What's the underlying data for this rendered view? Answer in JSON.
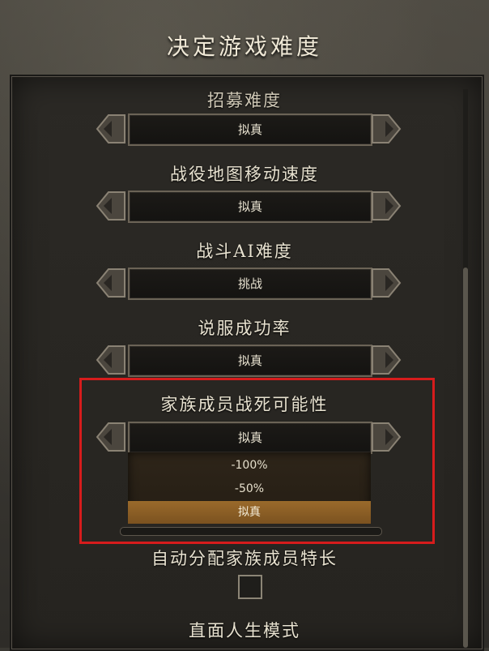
{
  "title": "决定游戏难度",
  "settings": [
    {
      "label": "招募难度",
      "value": "拟真"
    },
    {
      "label": "战役地图移动速度",
      "value": "拟真"
    },
    {
      "label": "战斗AI难度",
      "value": "挑战"
    },
    {
      "label": "说服成功率",
      "value": "拟真"
    },
    {
      "label": "家族成员战死可能性",
      "value": "拟真"
    }
  ],
  "dropdown_options": [
    {
      "label": "-100%",
      "selected": false
    },
    {
      "label": "-50%",
      "selected": false
    },
    {
      "label": "拟真",
      "selected": true
    }
  ],
  "auto_assign": {
    "label": "自动分配家族成员特长",
    "checked": false
  },
  "ironman": {
    "label": "直面人生模式"
  },
  "colors": {
    "highlight": "#d61c1c",
    "selected_option": "#8a5e26"
  },
  "icons": {
    "left_arrow": "chevron-left-icon",
    "right_arrow": "chevron-right-icon"
  }
}
